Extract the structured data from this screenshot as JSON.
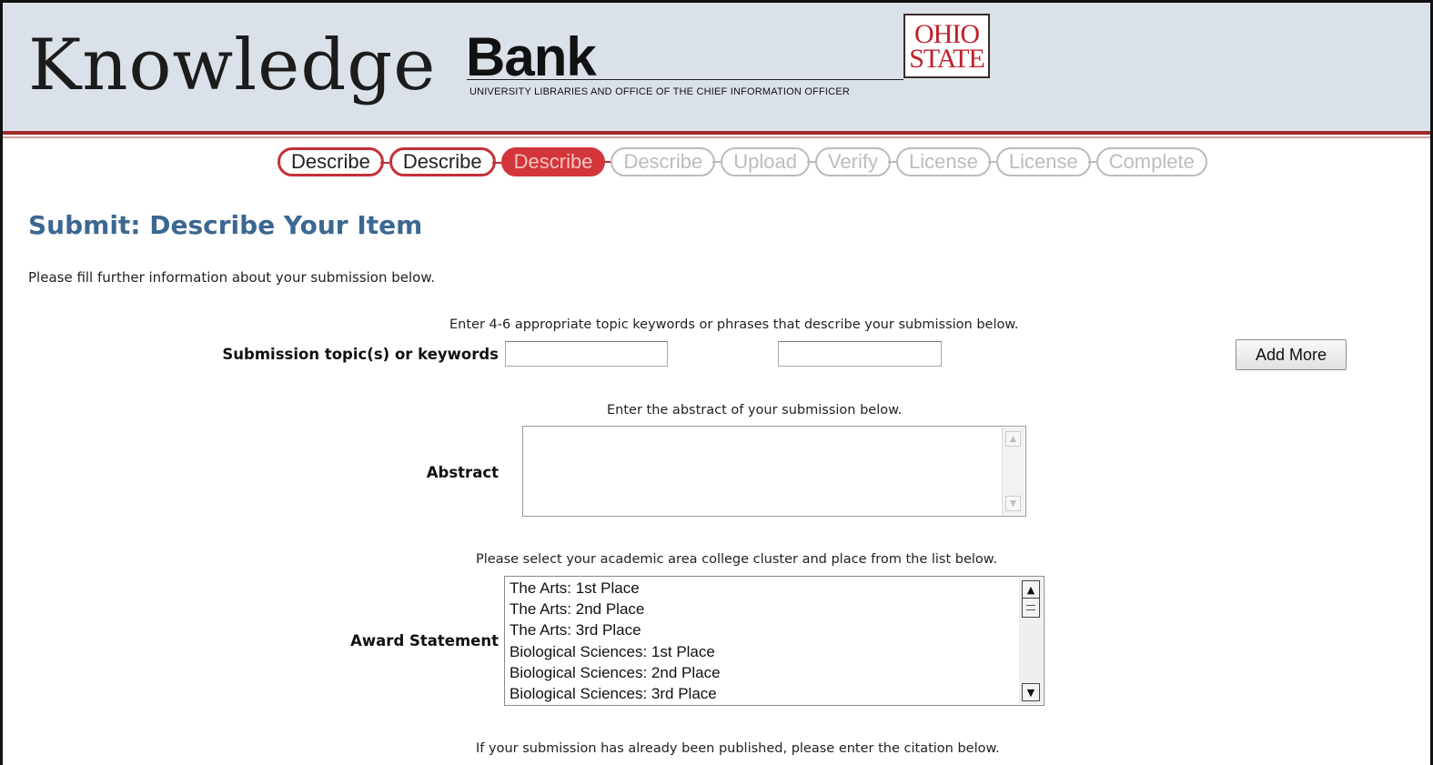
{
  "header": {
    "logo_knowledge": "Knowledge",
    "logo_bank": "Bank",
    "logo_subtitle": "UNIVERSITY LIBRARIES AND OFFICE OF THE CHIEF INFORMATION OFFICER",
    "seal_line1": "OHIO",
    "seal_line2": "STATE"
  },
  "progress": {
    "steps": [
      {
        "label": "Describe",
        "state": "done"
      },
      {
        "label": "Describe",
        "state": "done"
      },
      {
        "label": "Describe",
        "state": "current"
      },
      {
        "label": "Describe",
        "state": "pending"
      },
      {
        "label": "Upload",
        "state": "pending"
      },
      {
        "label": "Verify",
        "state": "pending"
      },
      {
        "label": "License",
        "state": "pending"
      },
      {
        "label": "License",
        "state": "pending"
      },
      {
        "label": "Complete",
        "state": "pending"
      }
    ]
  },
  "page": {
    "title": "Submit: Describe Your Item",
    "intro": "Please fill further information about your submission below."
  },
  "keywords": {
    "hint": "Enter 4-6 appropriate topic keywords or phrases that describe your submission below.",
    "label": "Submission topic(s) or keywords",
    "value1": "",
    "value2": "",
    "add_more_label": "Add More"
  },
  "abstract": {
    "hint": "Enter the abstract of your submission below.",
    "label": "Abstract",
    "value": ""
  },
  "award": {
    "hint": "Please select your academic area college cluster and place from the list below.",
    "label": "Award Statement",
    "options": [
      "The Arts: 1st Place",
      "The Arts: 2nd Place",
      "The Arts: 3rd Place",
      "Biological Sciences: 1st Place",
      "Biological Sciences: 2nd Place",
      "Biological Sciences: 3rd Place"
    ]
  },
  "citation": {
    "hint": "If your submission has already been published, please enter the citation below."
  },
  "colors": {
    "accent_red": "#c62f36",
    "title_blue": "#3b6892",
    "banner_bg": "#dbe1e9"
  },
  "icons": {
    "scroll_up": "scroll-up-arrow-icon",
    "scroll_down": "scroll-down-arrow-icon"
  }
}
